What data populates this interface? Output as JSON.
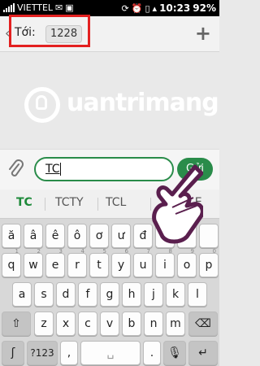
{
  "status_bar": {
    "carrier": "VIETTEL",
    "time": "10:23",
    "battery": "92%"
  },
  "header": {
    "to_label": "Tới:",
    "recipient": "1228"
  },
  "watermark": {
    "text": "uantrimang"
  },
  "compose": {
    "message_value": "TC",
    "send_label": "Gửi"
  },
  "suggestions": [
    "TC",
    "TCTY",
    "TCL",
    "LE"
  ],
  "keyboard": {
    "row1": [
      "ă",
      "â",
      "ê",
      "ô",
      "ơ",
      "ư",
      "đ",
      "",
      "",
      ""
    ],
    "row2": [
      "q",
      "w",
      "e",
      "r",
      "t",
      "y",
      "u",
      "i",
      "o",
      "p"
    ],
    "row2_sub": [
      "1",
      "2",
      "3",
      "4",
      "5",
      "6",
      "7",
      "8",
      "9",
      "0"
    ],
    "row3": [
      "a",
      "s",
      "d",
      "f",
      "g",
      "h",
      "j",
      "k",
      "l"
    ],
    "row4": [
      "z",
      "x",
      "c",
      "v",
      "b",
      "n",
      "m"
    ],
    "row5": {
      "num_label": "?123",
      "comma": ",",
      "period": "."
    }
  },
  "colors": {
    "accent_green": "#2a8c4a",
    "highlight_red": "#e32020"
  }
}
